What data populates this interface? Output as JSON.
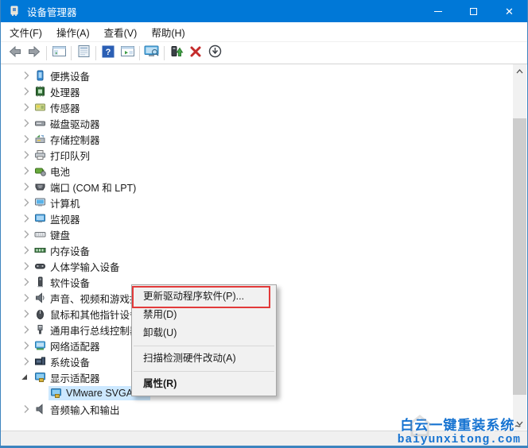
{
  "window": {
    "title": "设备管理器",
    "controls": [
      {
        "name": "minimize"
      },
      {
        "name": "maximize"
      },
      {
        "name": "close"
      }
    ]
  },
  "menu_bar": {
    "items": [
      {
        "name": "menu-file",
        "label": "文件(F)"
      },
      {
        "name": "menu-action",
        "label": "操作(A)"
      },
      {
        "name": "menu-view",
        "label": "查看(V)"
      },
      {
        "name": "menu-help",
        "label": "帮助(H)"
      }
    ]
  },
  "toolbar": {
    "buttons": [
      {
        "name": "back"
      },
      {
        "name": "forward"
      },
      {
        "sep": true
      },
      {
        "name": "console-tree"
      },
      {
        "sep": true
      },
      {
        "name": "properties"
      },
      {
        "sep": true
      },
      {
        "name": "help"
      },
      {
        "name": "action-pane"
      },
      {
        "sep": true
      },
      {
        "name": "scan-hardware-changes"
      },
      {
        "sep": true
      },
      {
        "name": "update-driver"
      },
      {
        "name": "uninstall"
      },
      {
        "name": "disable"
      }
    ]
  },
  "tree": {
    "items": [
      {
        "label": "便携设备",
        "icon": "portable-device",
        "chevron": "collapsed",
        "level": 1
      },
      {
        "label": "处理器",
        "icon": "processor",
        "chevron": "collapsed",
        "level": 1
      },
      {
        "label": "传感器",
        "icon": "sensor",
        "chevron": "collapsed",
        "level": 1
      },
      {
        "label": "磁盘驱动器",
        "icon": "disk-drive",
        "chevron": "collapsed",
        "level": 1
      },
      {
        "label": "存储控制器",
        "icon": "storage-controller",
        "chevron": "collapsed",
        "level": 1
      },
      {
        "label": "打印队列",
        "icon": "printer",
        "chevron": "collapsed",
        "level": 1
      },
      {
        "label": "电池",
        "icon": "battery",
        "chevron": "collapsed",
        "level": 1
      },
      {
        "label": "端口 (COM 和 LPT)",
        "icon": "port",
        "chevron": "collapsed",
        "level": 1
      },
      {
        "label": "计算机",
        "icon": "computer",
        "chevron": "collapsed",
        "level": 1
      },
      {
        "label": "监视器",
        "icon": "monitor",
        "chevron": "collapsed",
        "level": 1
      },
      {
        "label": "键盘",
        "icon": "keyboard",
        "chevron": "collapsed",
        "level": 1
      },
      {
        "label": "内存设备",
        "icon": "memory",
        "chevron": "collapsed",
        "level": 1
      },
      {
        "label": "人体学输入设备",
        "icon": "hid",
        "chevron": "collapsed",
        "level": 1
      },
      {
        "label": "软件设备",
        "icon": "software-device",
        "chevron": "collapsed",
        "level": 1
      },
      {
        "label": "声音、视频和游戏控制器",
        "icon": "sound",
        "chevron": "collapsed",
        "level": 1
      },
      {
        "label": "鼠标和其他指针设备",
        "icon": "mouse",
        "chevron": "collapsed",
        "level": 1
      },
      {
        "label": "通用串行总线控制器",
        "icon": "usb",
        "chevron": "collapsed",
        "level": 1
      },
      {
        "label": "网络适配器",
        "icon": "network-adapter",
        "chevron": "collapsed",
        "level": 1
      },
      {
        "label": "系统设备",
        "icon": "system-device",
        "chevron": "collapsed",
        "level": 1
      },
      {
        "label": "显示适配器",
        "icon": "display-adapter",
        "chevron": "expanded",
        "level": 1
      },
      {
        "label": "VMware SVGA 3D",
        "icon": "display-adapter",
        "chevron": "none",
        "level": 2,
        "selected": true
      },
      {
        "label": "音频输入和输出",
        "icon": "audio",
        "chevron": "collapsed",
        "level": 1
      }
    ]
  },
  "context_menu": {
    "items": [
      {
        "label": "更新驱动程序软件(P)...",
        "red_box": true
      },
      {
        "label": "禁用(D)"
      },
      {
        "label": "卸载(U)"
      },
      {
        "type": "separator"
      },
      {
        "label": "扫描检测硬件改动(A)"
      },
      {
        "type": "separator"
      },
      {
        "label": "属性(R)",
        "bold": true
      }
    ]
  },
  "watermark": {
    "line1": "白云一键重装系统",
    "tilde": "~",
    "line2": "baiyunxitong.com"
  },
  "colors": {
    "titlebar": "#0078d7",
    "selection": "#cce8ff",
    "red_box": "#e23a3a",
    "watermark_blue": "#1673d1"
  }
}
